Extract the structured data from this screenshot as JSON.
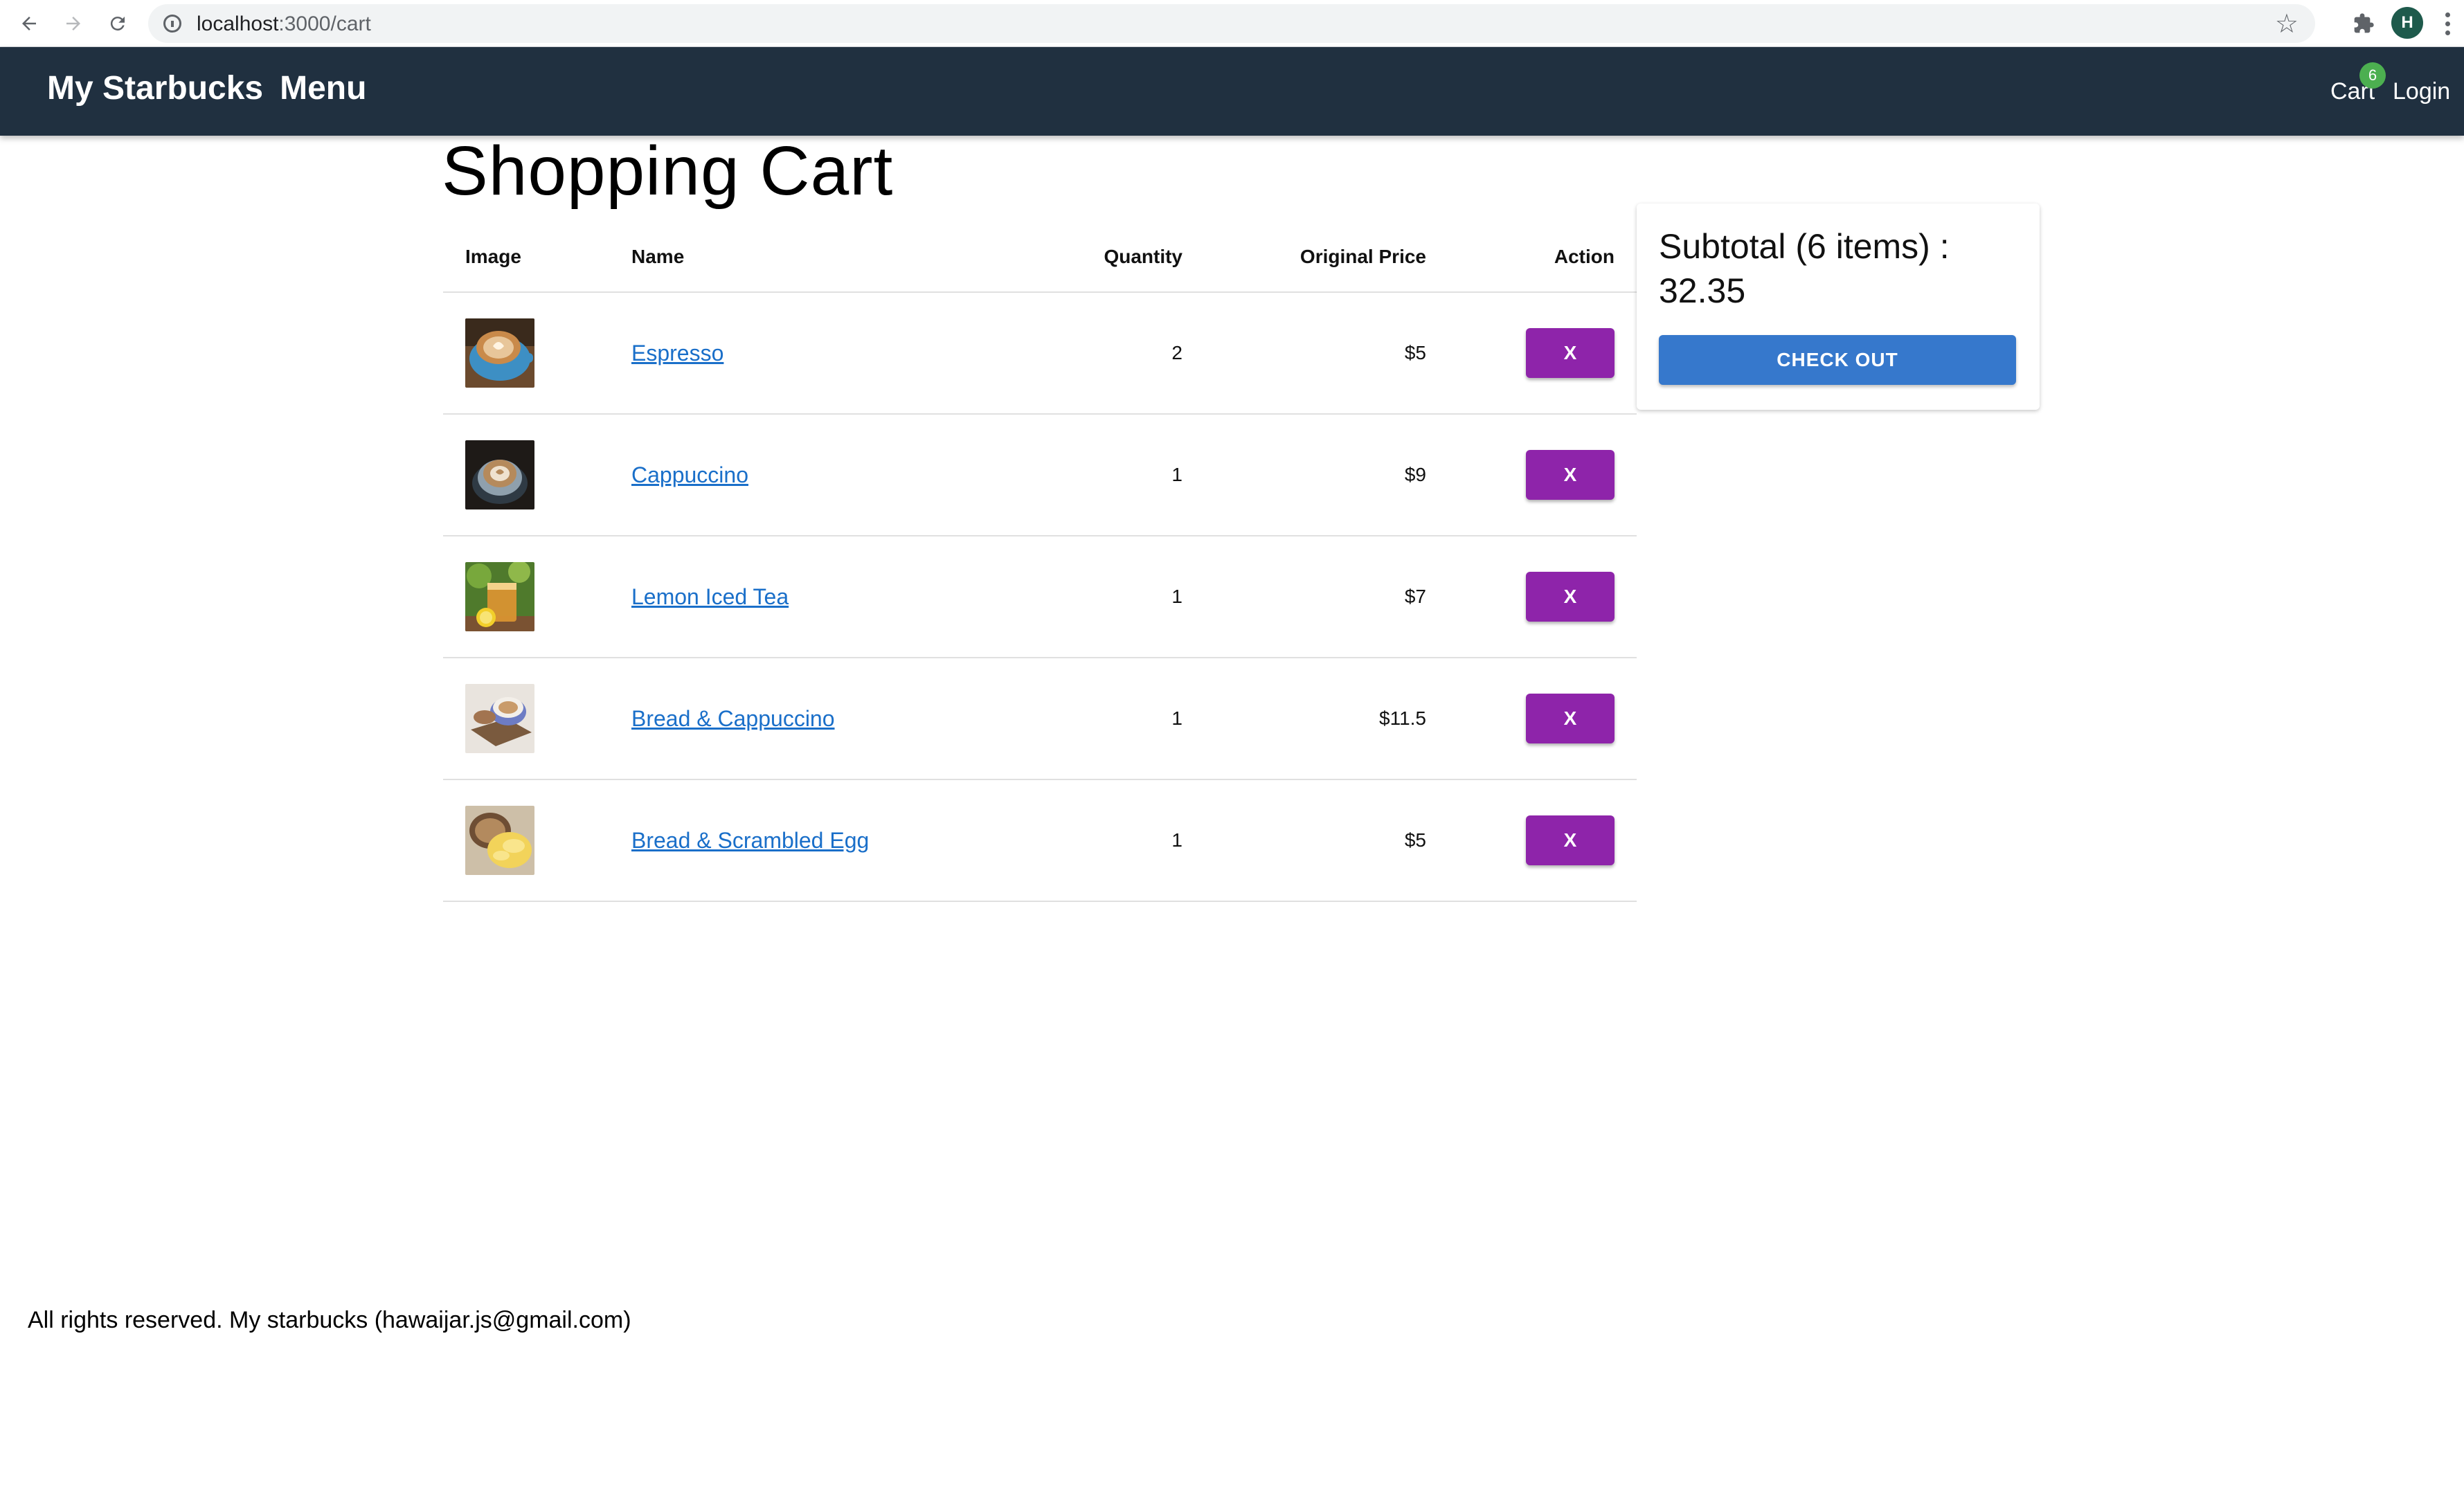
{
  "browser": {
    "url_host": "localhost",
    "url_rest": ":3000/cart",
    "profile_initial": "H"
  },
  "header": {
    "brand": "My Starbucks",
    "menu_label": "Menu",
    "cart_label": "Cart",
    "cart_count": "6",
    "login_label": "Login",
    "bg_color": "#203040"
  },
  "page": {
    "title": "Shopping Cart"
  },
  "table": {
    "columns": [
      "Image",
      "Name",
      "Quantity",
      "Original Price",
      "Action"
    ],
    "rows": [
      {
        "name": "Espresso",
        "quantity": "2",
        "price": "$5",
        "action": "X",
        "image_icon": "espresso-image"
      },
      {
        "name": "Cappuccino",
        "quantity": "1",
        "price": "$9",
        "action": "X",
        "image_icon": "cappuccino-image"
      },
      {
        "name": "Lemon Iced Tea",
        "quantity": "1",
        "price": "$7",
        "action": "X",
        "image_icon": "lemon-iced-tea-image"
      },
      {
        "name": "Bread & Cappuccino",
        "quantity": "1",
        "price": "$11.5",
        "action": "X",
        "image_icon": "bread-cappuccino-image"
      },
      {
        "name": "Bread & Scrambled Egg",
        "quantity": "1",
        "price": "$5",
        "action": "X",
        "image_icon": "bread-scrambled-egg-image"
      }
    ]
  },
  "summary": {
    "subtotal_text": "Subtotal (6 items) : 32.35",
    "checkout_label": "CHECK OUT"
  },
  "footer": {
    "text": "All rights reserved. My starbucks (hawaijar.js@gmail.com)"
  },
  "colors": {
    "remove_button": "#8e24aa",
    "checkout_button": "#3678cc",
    "link": "#1a6fc9",
    "badge": "#4caf50"
  }
}
